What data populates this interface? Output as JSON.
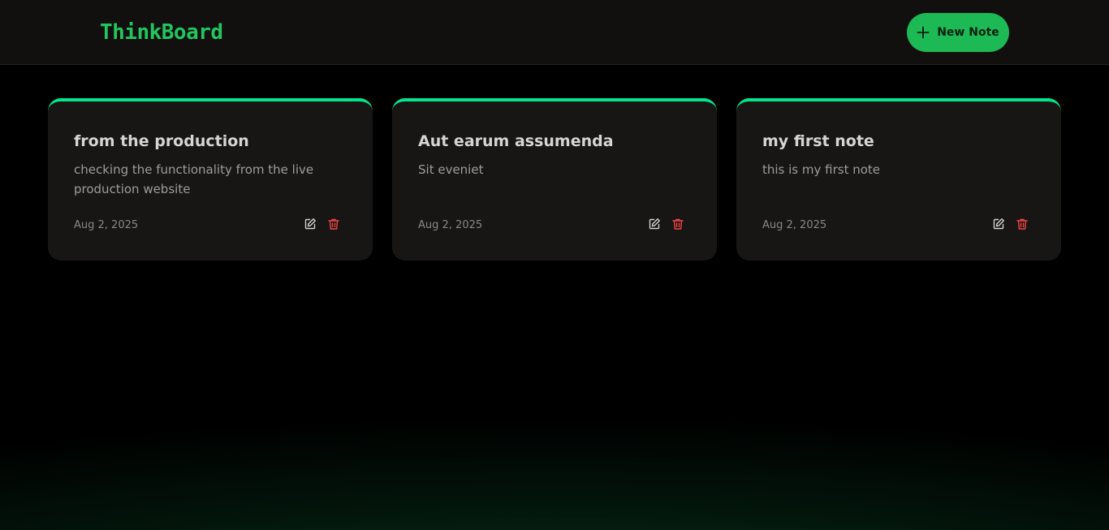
{
  "header": {
    "brand": "ThinkBoard",
    "new_note_label": "New Note",
    "new_note_icon": "plus-icon"
  },
  "notes": [
    {
      "title": "from the production",
      "content": "checking the functionality from the live production website",
      "date": "Aug 2, 2025",
      "edit_icon": "edit-icon",
      "delete_icon": "trash-icon"
    },
    {
      "title": "Aut earum assumenda",
      "content": "Sit eveniet",
      "date": "Aug 2, 2025",
      "edit_icon": "edit-icon",
      "delete_icon": "trash-icon"
    },
    {
      "title": "my first note",
      "content": "this is my first note",
      "date": "Aug 2, 2025",
      "edit_icon": "edit-icon",
      "delete_icon": "trash-icon"
    }
  ],
  "colors": {
    "brand": "#22c55e",
    "accent_button": "#1db954",
    "card_border": "#00e68a",
    "delete": "#ef4444",
    "card_bg": "#181515",
    "navbar_bg": "#120f0f"
  }
}
